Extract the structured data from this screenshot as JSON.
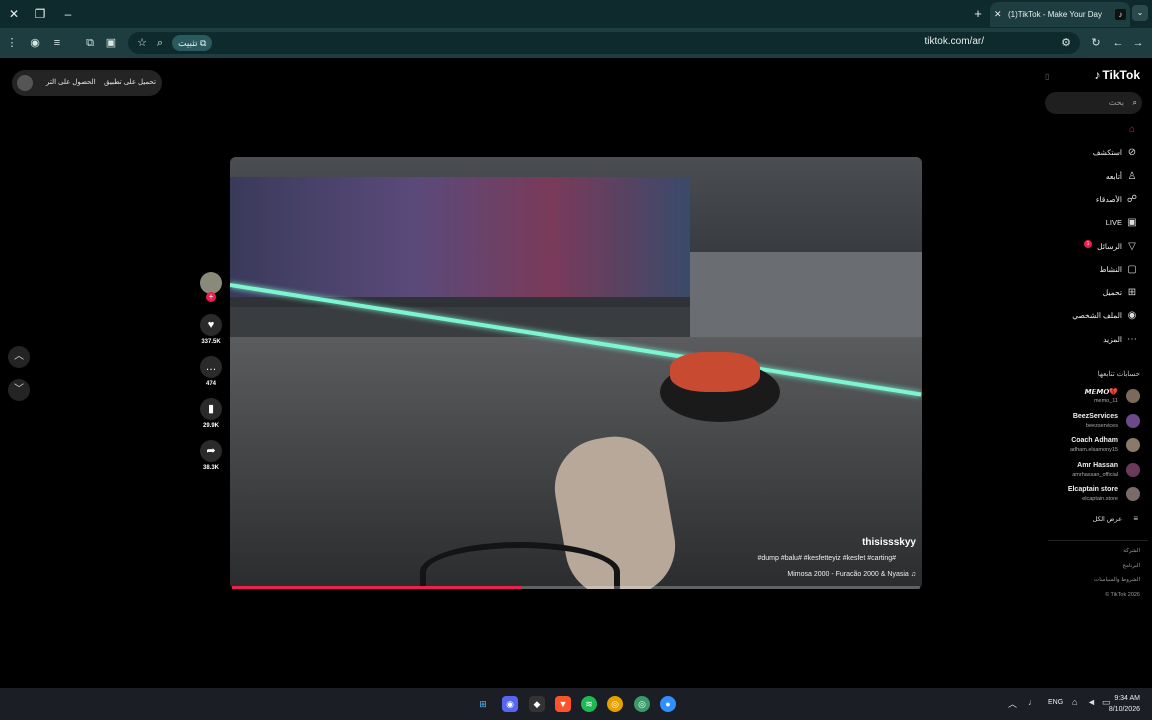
{
  "browser": {
    "tab_title": "(1)TikTok - Make Your Day",
    "url": "tiktok.com/ar/",
    "install_label": "تثبيت",
    "tab_close": "✕",
    "new_tab": "+",
    "win_close": "✕",
    "win_restore": "❐",
    "win_minimize": "–",
    "tab_menu": "⌄"
  },
  "top_pill": {
    "item1": "تحميل على تطبيق",
    "item2": "الحصول على التر"
  },
  "video": {
    "author": "thisissskyy",
    "description": "#dump #balu# #kesfetteyiz #kesfet #carting#",
    "music": "Mimosa 2000 - Furacão 2000 & Nyasia",
    "progress": 0.42
  },
  "actions": {
    "likes": "337.5K",
    "comments": "474",
    "saves": "29.9K",
    "shares": "38.3K"
  },
  "sidebar": {
    "logo": "TikTok",
    "search_placeholder": "بحث",
    "nav": [
      {
        "label": "",
        "icon": "home-icon"
      },
      {
        "label": "استكشف",
        "icon": "compass-icon"
      },
      {
        "label": "أتابعه",
        "icon": "user-follow-icon"
      },
      {
        "label": "الأصدقاء",
        "icon": "friends-icon"
      },
      {
        "label": "LIVE",
        "icon": "live-icon"
      },
      {
        "label": "الرسائل",
        "icon": "message-icon",
        "badge": "1"
      },
      {
        "label": "النشاط",
        "icon": "activity-icon"
      },
      {
        "label": "تحميل",
        "icon": "upload-icon"
      },
      {
        "label": "الملف الشخصي",
        "icon": "profile-icon"
      },
      {
        "label": "المزيد",
        "icon": "more-icon"
      }
    ],
    "following_header": "حسابات تتابعها",
    "following": [
      {
        "name": "𝙈𝙀𝙈𝙊💔",
        "handle": "memo_11"
      },
      {
        "name": "BeezServices",
        "handle": "beezservices"
      },
      {
        "name": "Coach Adham",
        "handle": "adham.elsamony15"
      },
      {
        "name": "Amr Hassan",
        "handle": "amrhassan_official"
      },
      {
        "name": "Elcaptain store",
        "handle": "elcaptain.store"
      }
    ],
    "see_all": "عرض الكل",
    "footer": [
      "الشركة",
      "البرنامج",
      "الشروط والسياسات",
      "© TikTok 2026"
    ]
  },
  "taskbar": {
    "time": "9:34 AM",
    "date": "8/10/2026",
    "lang": "ENG"
  }
}
